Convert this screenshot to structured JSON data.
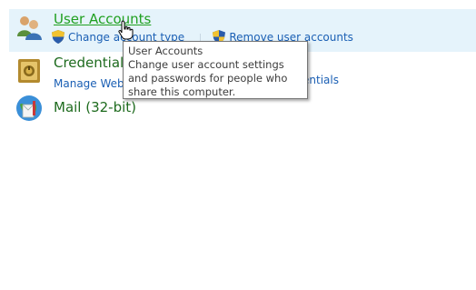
{
  "items": {
    "user_accounts": {
      "title": "User Accounts",
      "links": [
        "Change account type",
        "Remove user accounts"
      ],
      "icon": "user-accounts-icon"
    },
    "credential": {
      "title": "Credential",
      "link_left": "Manage Web C",
      "link_right": "entials",
      "icon": "credential-manager-icon"
    },
    "mail": {
      "title": "Mail (32-bit)",
      "icon": "mail-icon"
    }
  },
  "tooltip": {
    "title": "User Accounts",
    "body": "Change user account settings and passwords for people who share this computer."
  },
  "colors": {
    "hover_bg": "#e5f3fb",
    "title_green": "#1e6b1e",
    "link_blue": "#1a5fb4"
  }
}
